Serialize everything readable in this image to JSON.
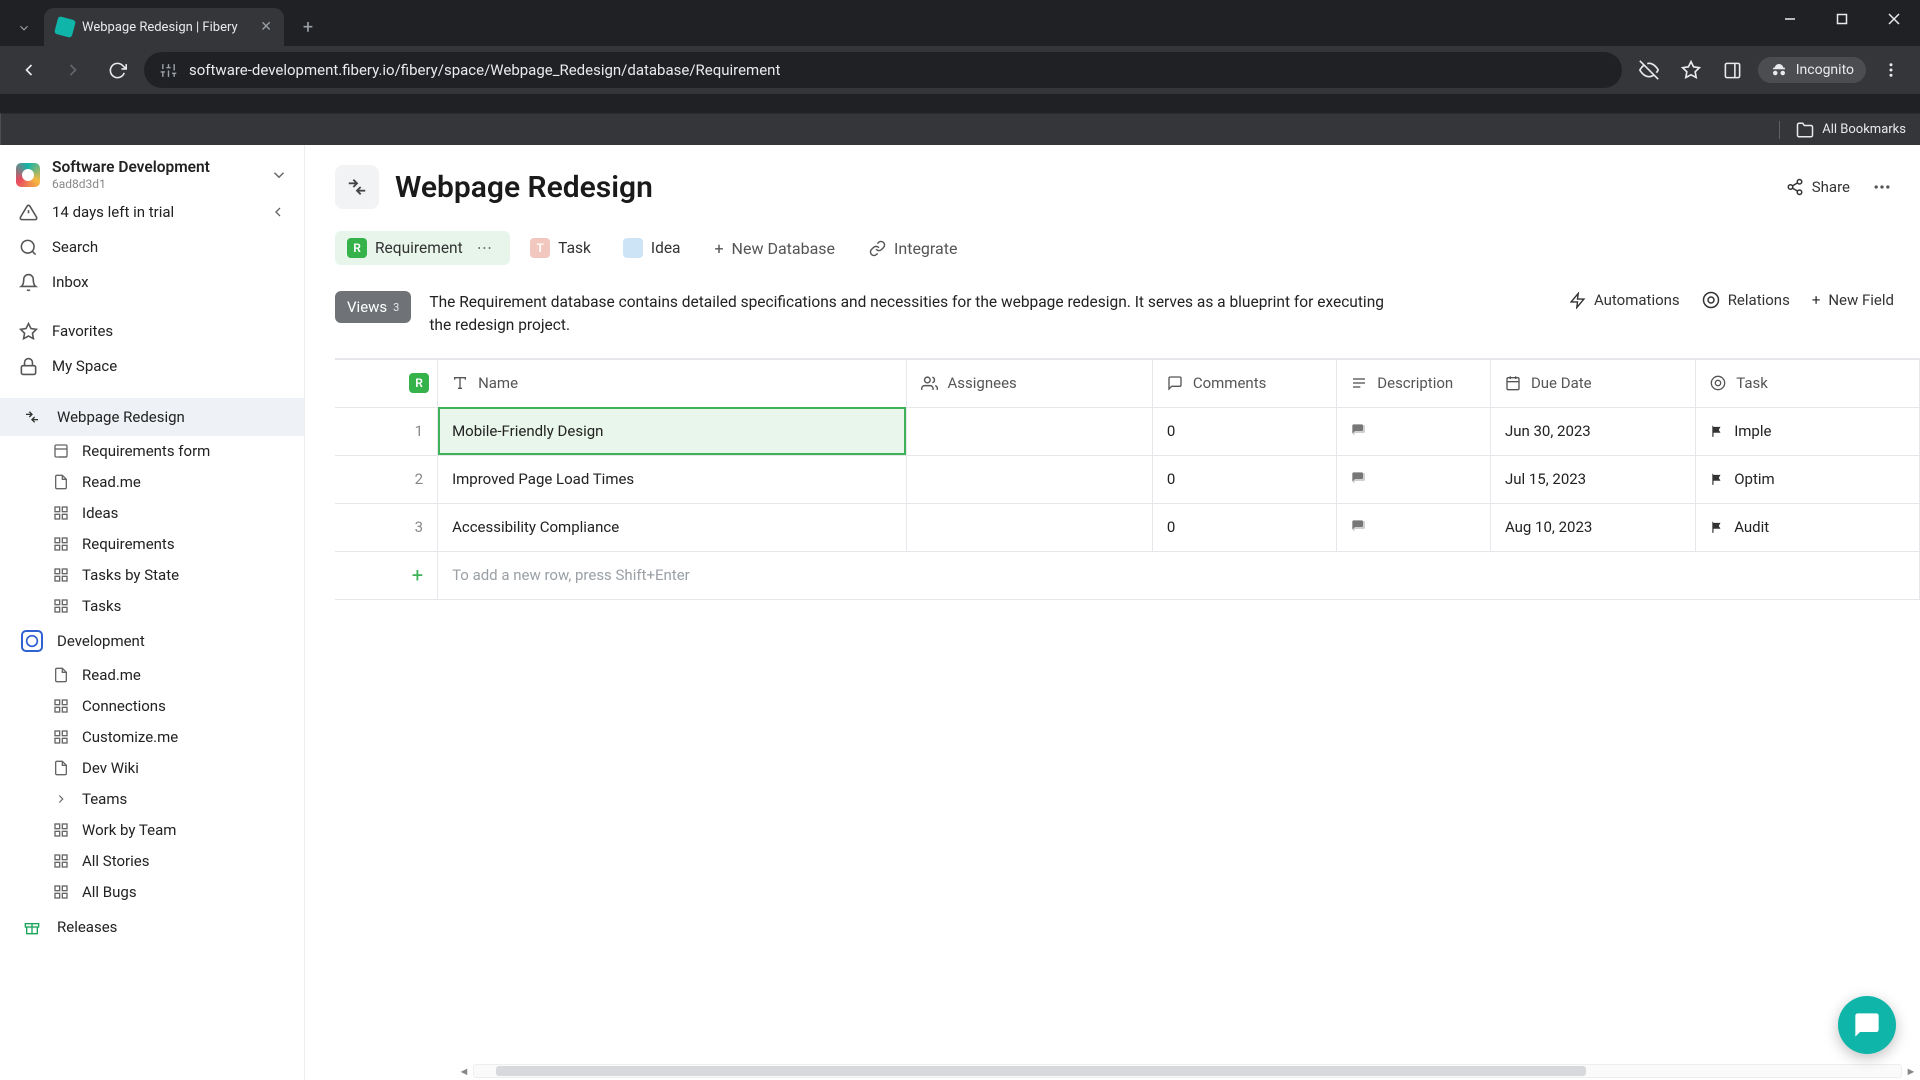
{
  "browser": {
    "tab_title": "Webpage Redesign | Fibery",
    "url": "software-development.fibery.io/fibery/space/Webpage_Redesign/database/Requirement",
    "incognito_label": "Incognito",
    "all_bookmarks": "All Bookmarks"
  },
  "workspace": {
    "name": "Software Development",
    "id": "6ad8d3d1",
    "trial": "14 days left in trial"
  },
  "sidebar_top": [
    {
      "icon": "search",
      "label": "Search"
    },
    {
      "icon": "inbox",
      "label": "Inbox"
    }
  ],
  "sidebar_mid": [
    {
      "icon": "star",
      "label": "Favorites"
    },
    {
      "icon": "lock",
      "label": "My Space"
    }
  ],
  "spaces": [
    {
      "name": "Webpage Redesign",
      "active": true,
      "icon": "arrows",
      "color": "#333",
      "children": [
        {
          "icon": "form",
          "label": "Requirements form"
        },
        {
          "icon": "doc",
          "label": "Read.me"
        },
        {
          "icon": "grid",
          "label": "Ideas"
        },
        {
          "icon": "grid",
          "label": "Requirements"
        },
        {
          "icon": "grid",
          "label": "Tasks by State"
        },
        {
          "icon": "grid",
          "label": "Tasks"
        }
      ]
    },
    {
      "name": "Development",
      "active": false,
      "icon": "dev",
      "color": "#3061d1",
      "children": [
        {
          "icon": "doc",
          "label": "Read.me"
        },
        {
          "icon": "grid",
          "label": "Connections"
        },
        {
          "icon": "grid",
          "label": "Customize.me"
        },
        {
          "icon": "doc",
          "label": "Dev Wiki"
        },
        {
          "icon": "chev",
          "label": "Teams"
        },
        {
          "icon": "grid",
          "label": "Work by Team"
        },
        {
          "icon": "grid",
          "label": "All Stories"
        },
        {
          "icon": "grid",
          "label": "All Bugs"
        }
      ]
    },
    {
      "name": "Releases",
      "active": false,
      "icon": "gift",
      "color": "#18a558",
      "children": []
    }
  ],
  "page": {
    "title": "Webpage Redesign",
    "share": "Share"
  },
  "db_tabs": [
    {
      "label": "Requirement",
      "badge": "R",
      "color": "#36b24a",
      "active": true
    },
    {
      "label": "Task",
      "badge": "T",
      "color": "#f2c7bd",
      "active": false
    },
    {
      "label": "Idea",
      "badge": "",
      "color": "#cde4f7",
      "active": false
    }
  ],
  "db_tab_actions": {
    "new_db": "New Database",
    "integrate": "Integrate"
  },
  "views": {
    "label": "Views",
    "count": "3"
  },
  "description": "The Requirement database contains detailed specifications and necessities for the webpage redesign. It serves as a blueprint for executing the redesign project.",
  "db_actions": {
    "automations": "Automations",
    "relations": "Relations",
    "new_field": "New Field"
  },
  "columns": {
    "name": "Name",
    "assignees": "Assignees",
    "comments": "Comments",
    "description": "Description",
    "due": "Due Date",
    "task": "Task"
  },
  "rows": [
    {
      "n": "1",
      "name": "Mobile-Friendly Design",
      "assignees": "",
      "comments": "0",
      "due": "Jun 30, 2023",
      "task": "Imple",
      "selected": true
    },
    {
      "n": "2",
      "name": "Improved Page Load Times",
      "assignees": "",
      "comments": "0",
      "due": "Jul 15, 2023",
      "task": "Optim",
      "selected": false
    },
    {
      "n": "3",
      "name": "Accessibility Compliance",
      "assignees": "",
      "comments": "0",
      "due": "Aug 10, 2023",
      "task": "Audit",
      "selected": false
    }
  ],
  "add_row_hint": "To add a new row, press Shift+Enter"
}
